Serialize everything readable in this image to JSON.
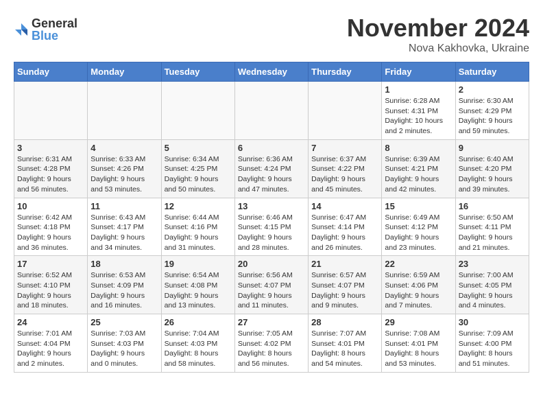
{
  "logo": {
    "general": "General",
    "blue": "Blue"
  },
  "header": {
    "month": "November 2024",
    "location": "Nova Kakhovka, Ukraine"
  },
  "weekdays": [
    "Sunday",
    "Monday",
    "Tuesday",
    "Wednesday",
    "Thursday",
    "Friday",
    "Saturday"
  ],
  "weeks": [
    [
      {
        "day": "",
        "info": ""
      },
      {
        "day": "",
        "info": ""
      },
      {
        "day": "",
        "info": ""
      },
      {
        "day": "",
        "info": ""
      },
      {
        "day": "",
        "info": ""
      },
      {
        "day": "1",
        "info": "Sunrise: 6:28 AM\nSunset: 4:31 PM\nDaylight: 10 hours and 2 minutes."
      },
      {
        "day": "2",
        "info": "Sunrise: 6:30 AM\nSunset: 4:29 PM\nDaylight: 9 hours and 59 minutes."
      }
    ],
    [
      {
        "day": "3",
        "info": "Sunrise: 6:31 AM\nSunset: 4:28 PM\nDaylight: 9 hours and 56 minutes."
      },
      {
        "day": "4",
        "info": "Sunrise: 6:33 AM\nSunset: 4:26 PM\nDaylight: 9 hours and 53 minutes."
      },
      {
        "day": "5",
        "info": "Sunrise: 6:34 AM\nSunset: 4:25 PM\nDaylight: 9 hours and 50 minutes."
      },
      {
        "day": "6",
        "info": "Sunrise: 6:36 AM\nSunset: 4:24 PM\nDaylight: 9 hours and 47 minutes."
      },
      {
        "day": "7",
        "info": "Sunrise: 6:37 AM\nSunset: 4:22 PM\nDaylight: 9 hours and 45 minutes."
      },
      {
        "day": "8",
        "info": "Sunrise: 6:39 AM\nSunset: 4:21 PM\nDaylight: 9 hours and 42 minutes."
      },
      {
        "day": "9",
        "info": "Sunrise: 6:40 AM\nSunset: 4:20 PM\nDaylight: 9 hours and 39 minutes."
      }
    ],
    [
      {
        "day": "10",
        "info": "Sunrise: 6:42 AM\nSunset: 4:18 PM\nDaylight: 9 hours and 36 minutes."
      },
      {
        "day": "11",
        "info": "Sunrise: 6:43 AM\nSunset: 4:17 PM\nDaylight: 9 hours and 34 minutes."
      },
      {
        "day": "12",
        "info": "Sunrise: 6:44 AM\nSunset: 4:16 PM\nDaylight: 9 hours and 31 minutes."
      },
      {
        "day": "13",
        "info": "Sunrise: 6:46 AM\nSunset: 4:15 PM\nDaylight: 9 hours and 28 minutes."
      },
      {
        "day": "14",
        "info": "Sunrise: 6:47 AM\nSunset: 4:14 PM\nDaylight: 9 hours and 26 minutes."
      },
      {
        "day": "15",
        "info": "Sunrise: 6:49 AM\nSunset: 4:12 PM\nDaylight: 9 hours and 23 minutes."
      },
      {
        "day": "16",
        "info": "Sunrise: 6:50 AM\nSunset: 4:11 PM\nDaylight: 9 hours and 21 minutes."
      }
    ],
    [
      {
        "day": "17",
        "info": "Sunrise: 6:52 AM\nSunset: 4:10 PM\nDaylight: 9 hours and 18 minutes."
      },
      {
        "day": "18",
        "info": "Sunrise: 6:53 AM\nSunset: 4:09 PM\nDaylight: 9 hours and 16 minutes."
      },
      {
        "day": "19",
        "info": "Sunrise: 6:54 AM\nSunset: 4:08 PM\nDaylight: 9 hours and 13 minutes."
      },
      {
        "day": "20",
        "info": "Sunrise: 6:56 AM\nSunset: 4:07 PM\nDaylight: 9 hours and 11 minutes."
      },
      {
        "day": "21",
        "info": "Sunrise: 6:57 AM\nSunset: 4:07 PM\nDaylight: 9 hours and 9 minutes."
      },
      {
        "day": "22",
        "info": "Sunrise: 6:59 AM\nSunset: 4:06 PM\nDaylight: 9 hours and 7 minutes."
      },
      {
        "day": "23",
        "info": "Sunrise: 7:00 AM\nSunset: 4:05 PM\nDaylight: 9 hours and 4 minutes."
      }
    ],
    [
      {
        "day": "24",
        "info": "Sunrise: 7:01 AM\nSunset: 4:04 PM\nDaylight: 9 hours and 2 minutes."
      },
      {
        "day": "25",
        "info": "Sunrise: 7:03 AM\nSunset: 4:03 PM\nDaylight: 9 hours and 0 minutes."
      },
      {
        "day": "26",
        "info": "Sunrise: 7:04 AM\nSunset: 4:03 PM\nDaylight: 8 hours and 58 minutes."
      },
      {
        "day": "27",
        "info": "Sunrise: 7:05 AM\nSunset: 4:02 PM\nDaylight: 8 hours and 56 minutes."
      },
      {
        "day": "28",
        "info": "Sunrise: 7:07 AM\nSunset: 4:01 PM\nDaylight: 8 hours and 54 minutes."
      },
      {
        "day": "29",
        "info": "Sunrise: 7:08 AM\nSunset: 4:01 PM\nDaylight: 8 hours and 53 minutes."
      },
      {
        "day": "30",
        "info": "Sunrise: 7:09 AM\nSunset: 4:00 PM\nDaylight: 8 hours and 51 minutes."
      }
    ]
  ]
}
